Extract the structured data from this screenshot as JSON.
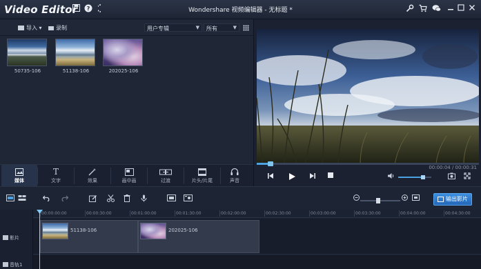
{
  "app": {
    "name": "Video Editor",
    "window_title": "Wondershare 视频编辑器 - 无标题 *"
  },
  "media": {
    "import_label": "导入 ▾",
    "record_label": "录制",
    "album_select": "用户专辑",
    "filter_select": "所有",
    "clips": [
      {
        "name": "50735-106"
      },
      {
        "name": "51138-106"
      },
      {
        "name": "202025-106"
      }
    ]
  },
  "tabs": [
    {
      "label": "媒体",
      "icon": "media-icon"
    },
    {
      "label": "文字",
      "icon": "text-icon"
    },
    {
      "label": "效果",
      "icon": "effects-icon"
    },
    {
      "label": "画中画",
      "icon": "pip-icon"
    },
    {
      "label": "过渡",
      "icon": "transition-icon"
    },
    {
      "label": "片头/片尾",
      "icon": "intro-outro-icon"
    },
    {
      "label": "声音",
      "icon": "sound-icon"
    }
  ],
  "preview": {
    "time": "00:00:04 / 00:00:31",
    "progress": 0.06,
    "volume": 0.75
  },
  "timeline": {
    "export_label": "输出影片",
    "zoom": 0.45,
    "ruler": [
      "00:00:00:00",
      "00:00:30:00",
      "00:01:00:00",
      "00:01:30:00",
      "00:02:00:00",
      "00:02:30:00",
      "00:03:00:00",
      "00:03:30:00",
      "00:04:00:00",
      "00:04:30:00"
    ],
    "video_track_label": "影片",
    "audio_track_label": "音轨1",
    "clips": [
      {
        "name": "51138-106"
      },
      {
        "name": "202025-106"
      }
    ]
  },
  "colors": {
    "accent": "#3c8fe0",
    "background": "#1a2130"
  }
}
